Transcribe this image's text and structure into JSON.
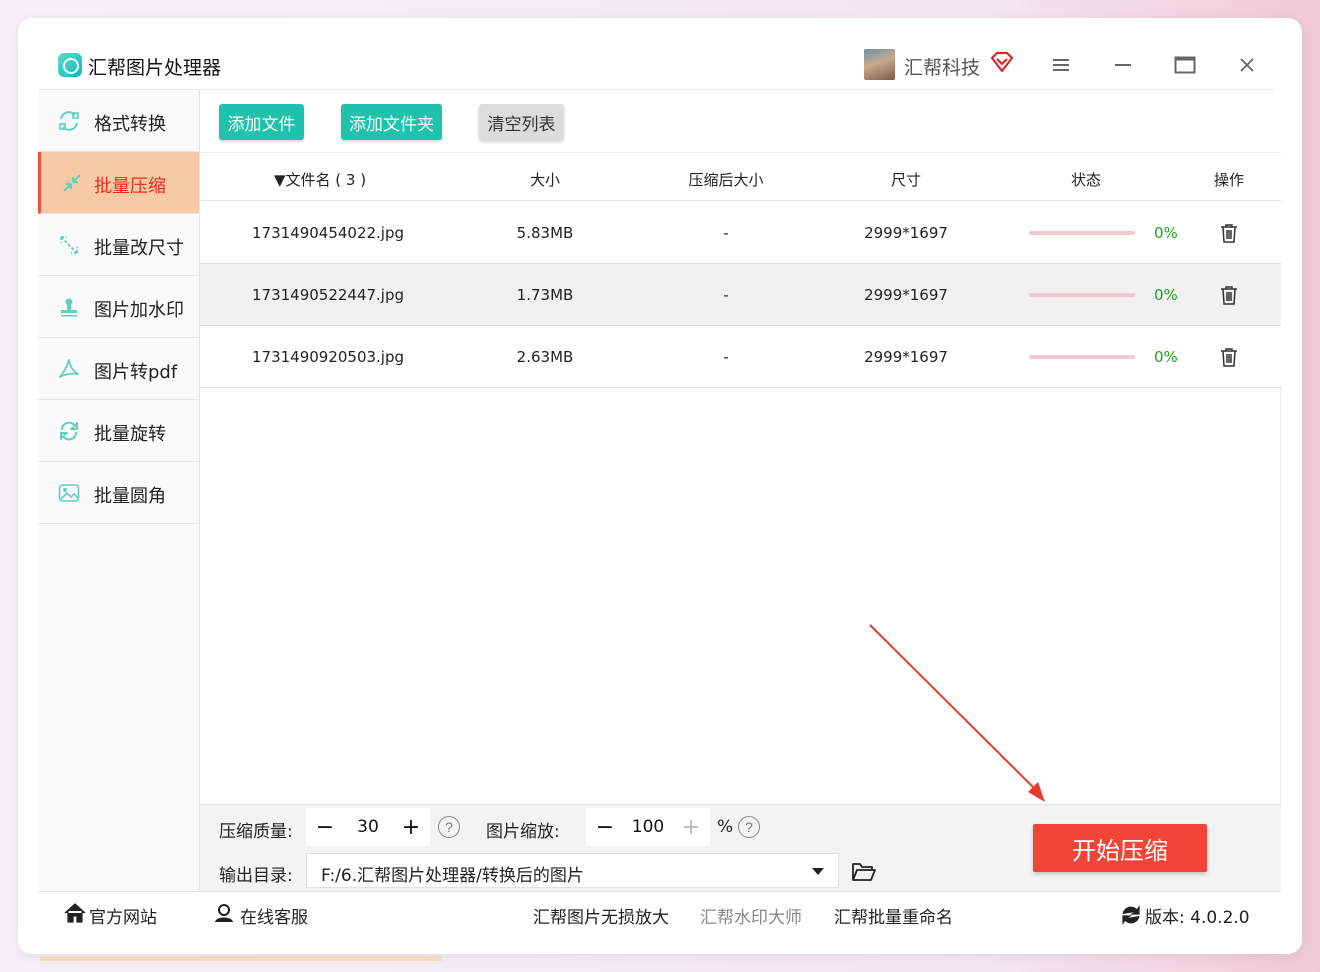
{
  "app": {
    "title": "汇帮图片处理器",
    "user_name": "汇帮科技"
  },
  "toolbar": {
    "add_file": "添加文件",
    "add_folder": "添加文件夹",
    "clear_list": "清空列表"
  },
  "sidebar": {
    "items": [
      {
        "label": "格式转换",
        "icon": "format-convert-icon"
      },
      {
        "label": "批量压缩",
        "icon": "compress-icon",
        "active": true
      },
      {
        "label": "批量改尺寸",
        "icon": "resize-icon"
      },
      {
        "label": "图片加水印",
        "icon": "watermark-icon"
      },
      {
        "label": "图片转pdf",
        "icon": "pdf-icon"
      },
      {
        "label": "批量旋转",
        "icon": "rotate-icon"
      },
      {
        "label": "批量圆角",
        "icon": "round-corner-icon"
      }
    ]
  },
  "table": {
    "headers": {
      "filename": "▼文件名 ( 3 )",
      "size": "大小",
      "compressed_size": "压缩后大小",
      "dimensions": "尺寸",
      "status": "状态",
      "action": "操作"
    },
    "rows": [
      {
        "filename": "1731490454022.jpg",
        "size": "5.83MB",
        "compressed": "-",
        "dimensions": "2999*1697",
        "progress": 0,
        "percent": "0%"
      },
      {
        "filename": "1731490522447.jpg",
        "size": "1.73MB",
        "compressed": "-",
        "dimensions": "2999*1697",
        "progress": 0,
        "percent": "0%"
      },
      {
        "filename": "1731490920503.jpg",
        "size": "2.63MB",
        "compressed": "-",
        "dimensions": "2999*1697",
        "progress": 0,
        "percent": "0%"
      }
    ]
  },
  "settings": {
    "quality_label": "压缩质量:",
    "quality_value": "30",
    "scale_label": "图片缩放:",
    "scale_value": "100",
    "scale_unit": "%",
    "output_label": "输出目录:",
    "output_path": "F:/6.汇帮图片处理器/转换后的图片",
    "help": "?",
    "minus": "−",
    "plus": "+"
  },
  "start_button": "开始压缩",
  "footer": {
    "website": "官方网站",
    "support": "在线客服",
    "link1": "汇帮图片无损放大",
    "link2": "汇帮水印大师",
    "link3": "汇帮批量重命名",
    "version": "版本:  4.0.2.0"
  },
  "colors": {
    "accent_teal": "#21c2ad",
    "start_red": "#f2453a",
    "active_bg": "#f8c9a5",
    "active_text": "#e52d1f",
    "percent_green": "#1aa51a"
  }
}
